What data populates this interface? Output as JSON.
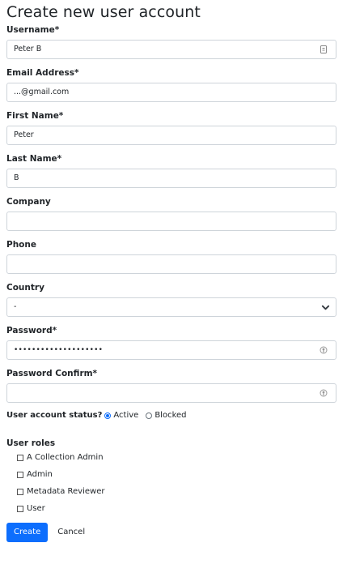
{
  "title": "Create new user account",
  "fields": {
    "username": {
      "label": "Username*",
      "value": "Peter B"
    },
    "email": {
      "label": "Email Address*",
      "value": "...@gmail.com"
    },
    "first_name": {
      "label": "First Name*",
      "value": "Peter"
    },
    "last_name": {
      "label": "Last Name*",
      "value": "B"
    },
    "company": {
      "label": "Company",
      "value": ""
    },
    "phone": {
      "label": "Phone",
      "value": ""
    },
    "country": {
      "label": "Country",
      "value": "-"
    },
    "password": {
      "label": "Password*",
      "value": "••••••••••••••••••••"
    },
    "password_confirm": {
      "label": "Password Confirm*",
      "value": ""
    }
  },
  "status": {
    "label": "User account status?",
    "options": [
      "Active",
      "Blocked"
    ],
    "selected": "Active"
  },
  "roles": {
    "title": "User roles",
    "items": [
      "A Collection Admin",
      "Admin",
      "Metadata Reviewer",
      "User"
    ]
  },
  "actions": {
    "create_label": "Create",
    "cancel_label": "Cancel"
  },
  "colors": {
    "primary": "#0d6efd",
    "border": "#ced4da"
  }
}
